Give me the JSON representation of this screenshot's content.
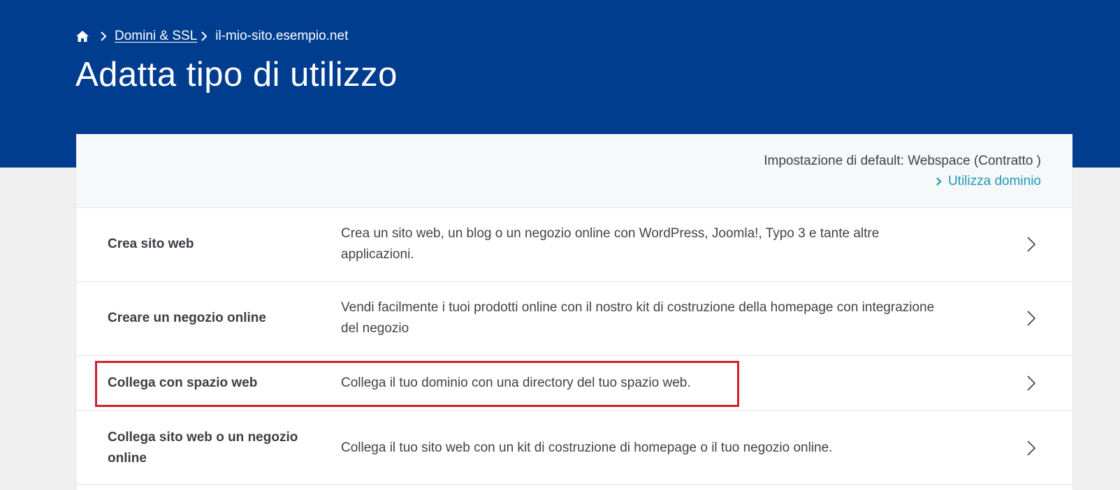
{
  "breadcrumb": {
    "home_icon": "home-icon",
    "items": [
      {
        "label": "Domini & SSL"
      },
      {
        "label": "il-mio-sito.esempio.net"
      }
    ]
  },
  "page": {
    "title": "Adatta tipo di utilizzo"
  },
  "settings": {
    "default_text": "Impostazione di default: Webspace (Contratto )",
    "use_domain_link": "Utilizza dominio"
  },
  "options": [
    {
      "title": "Crea sito web",
      "description": "Crea un sito web, un blog o un negozio online con WordPress, Joomla!, Typo 3 e tante altre applicazioni."
    },
    {
      "title": "Creare un negozio online",
      "description": "Vendi facilmente i tuoi prodotti online con il nostro kit di costruzione della homepage con integrazione del negozio"
    },
    {
      "title": "Collega con spazio web",
      "description": "Collega il tuo dominio con una directory del tuo spazio web."
    },
    {
      "title": "Collega sito web o un negozio online",
      "description": "Collega il tuo sito web con un kit di costruzione di homepage o il tuo negozio online."
    }
  ],
  "colors": {
    "header_bg": "#003d8f",
    "link": "#1a9ab5",
    "highlight": "#d0202e"
  }
}
